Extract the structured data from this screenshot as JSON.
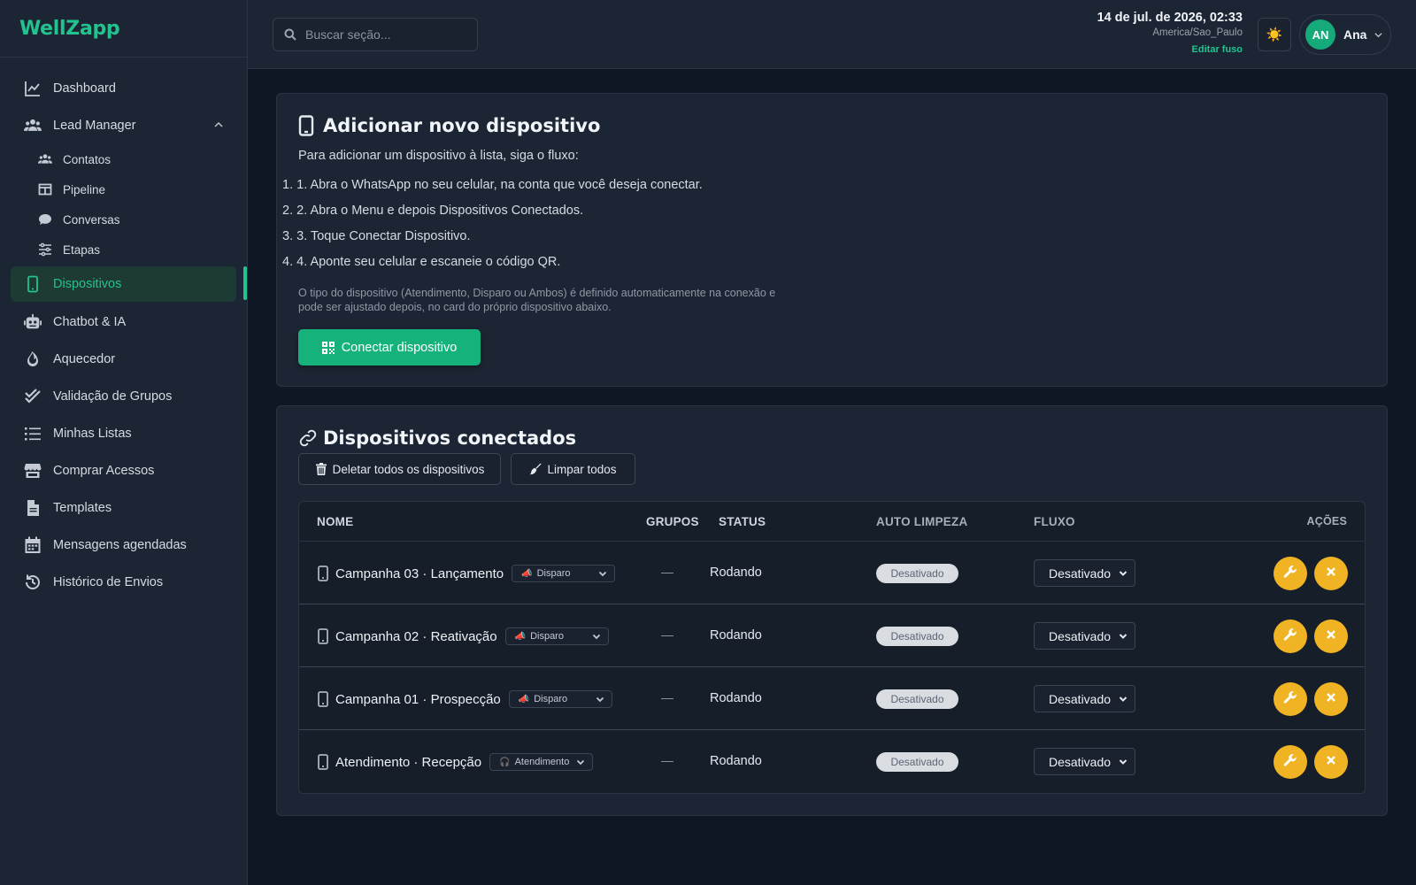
{
  "brand": "WellZapp",
  "sidebar": {
    "items": [
      {
        "label": "Dashboard"
      },
      {
        "label": "Lead Manager"
      },
      {
        "label": "Contatos"
      },
      {
        "label": "Pipeline"
      },
      {
        "label": "Conversas"
      },
      {
        "label": "Etapas"
      },
      {
        "label": "Dispositivos"
      },
      {
        "label": "Chatbot & IA"
      },
      {
        "label": "Aquecedor"
      },
      {
        "label": "Validação de Grupos"
      },
      {
        "label": "Minhas Listas"
      },
      {
        "label": "Comprar Acessos"
      },
      {
        "label": "Templates"
      },
      {
        "label": "Mensagens agendadas"
      },
      {
        "label": "Histórico de Envios"
      }
    ]
  },
  "topbar": {
    "search_placeholder": "Buscar seção...",
    "datetime": "14 de jul. de 2026, 02:33",
    "timezone": "America/Sao_Paulo",
    "edit_tz": "Editar fuso",
    "theme_icon": "☀️",
    "user_initials": "AN",
    "user_name": "Ana"
  },
  "add_card": {
    "title": "Adicionar novo dispositivo",
    "intro": "Para adicionar um dispositivo à lista, siga o fluxo:",
    "steps": [
      "1. Abra o WhatsApp no seu celular, na conta que você deseja conectar.",
      "2. Abra o Menu e depois Dispositivos Conectados.",
      "3. Toque Conectar Dispositivo.",
      "4. Aponte seu celular e escaneie o código QR."
    ],
    "step_numbers": [
      "1.",
      "2.",
      "3.",
      "4."
    ],
    "note": "O tipo do dispositivo (Atendimento, Disparo ou Ambos) é definido automaticamente na conexão e pode ser ajustado depois, no card do próprio dispositivo abaixo.",
    "connect_label": "Conectar dispositivo"
  },
  "devices_card": {
    "title": "Dispositivos conectados",
    "delete_all_label": "Deletar todos os dispositivos",
    "clean_all_label": "Limpar todos",
    "columns": {
      "name": "NOME",
      "groups": "GRUPOS",
      "status": "STATUS",
      "auto_clean": "AUTO LIMPEZA",
      "flow": "FLUXO",
      "actions": "AÇÕES"
    },
    "rows": [
      {
        "name": "Campanha 03 · Lançamento",
        "type_icon": "📣",
        "type": "Disparo",
        "groups": "—",
        "status": "Rodando",
        "auto_clean": "Desativado",
        "flow": "Desativado"
      },
      {
        "name": "Campanha 02 · Reativação",
        "type_icon": "📣",
        "type": "Disparo",
        "groups": "—",
        "status": "Rodando",
        "auto_clean": "Desativado",
        "flow": "Desativado"
      },
      {
        "name": "Campanha 01 · Prospecção",
        "type_icon": "📣",
        "type": "Disparo",
        "groups": "—",
        "status": "Rodando",
        "auto_clean": "Desativado",
        "flow": "Desativado"
      },
      {
        "name": "Atendimento · Recepção",
        "type_icon": "🎧",
        "type": "Atendimento",
        "groups": "—",
        "status": "Rodando",
        "auto_clean": "Desativado",
        "flow": "Desativado"
      }
    ]
  },
  "colors": {
    "accent": "#22c38e",
    "action": "#f0b323",
    "background": "#0f1724",
    "surface": "#1c2533"
  }
}
